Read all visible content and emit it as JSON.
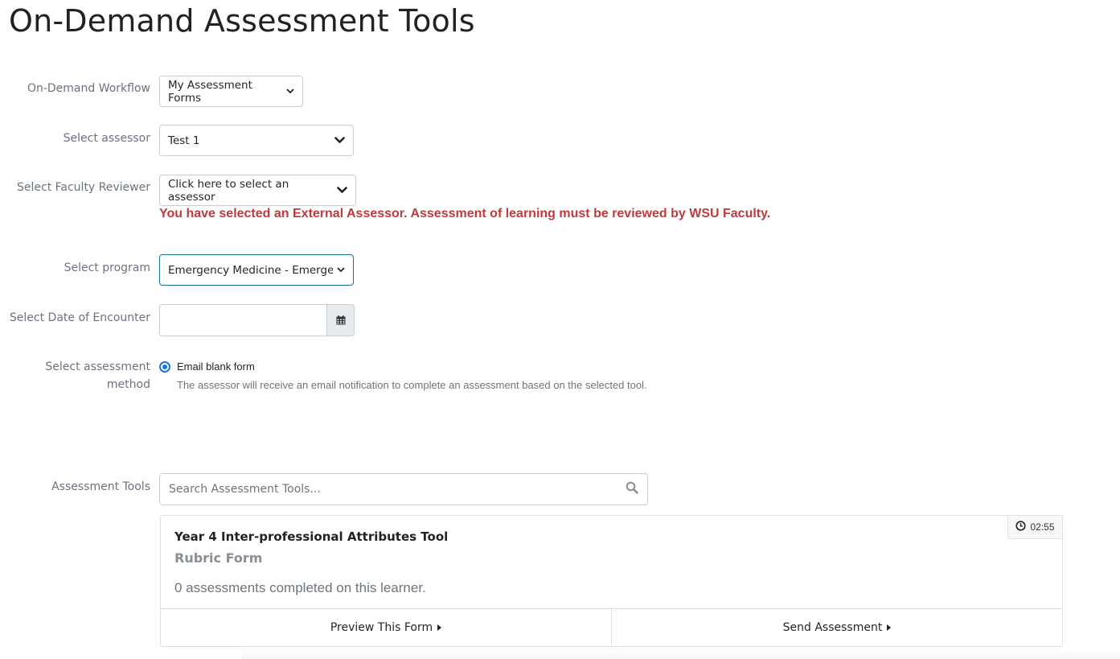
{
  "page": {
    "title": "On-Demand Assessment Tools"
  },
  "form": {
    "workflow": {
      "label": "On-Demand Workflow",
      "selected": "My Assessment Forms"
    },
    "assessor": {
      "label": "Select assessor",
      "selected": "Test 1"
    },
    "faculty_reviewer": {
      "label": "Select Faculty Reviewer",
      "placeholder": "Click here to select an assessor",
      "error": "You have selected an External Assessor. Assessment of learning must be reviewed by WSU Faculty."
    },
    "program": {
      "label": "Select program",
      "selected": "Emergency Medicine - Emergenc"
    },
    "encounter_date": {
      "label": "Select Date of Encounter",
      "value": ""
    },
    "method": {
      "label_line1": "Select assessment",
      "label_line2": "method",
      "option_label": "Email blank form",
      "option_help": "The assessor will receive an email notification to complete an assessment based on the selected tool."
    }
  },
  "tools": {
    "label": "Assessment Tools",
    "search_placeholder": "Search Assessment Tools...",
    "cards": [
      {
        "title": "Year 4 Inter-professional Attributes Tool",
        "subtitle": "Rubric Form",
        "count_text": "0 assessments completed on this learner.",
        "timer": "02:55",
        "preview_label": "Preview This Form",
        "send_label": "Send Assessment"
      }
    ]
  },
  "icons": {
    "dropdown": "chevron-down-icon",
    "calendar": "calendar-icon",
    "search": "search-icon",
    "clock": "clock-icon",
    "action_arrow": "caret-right-icon"
  },
  "colors": {
    "error": "#c0393b",
    "radio_accent": "#1a73e8",
    "active_border": "#1a6fa0"
  }
}
